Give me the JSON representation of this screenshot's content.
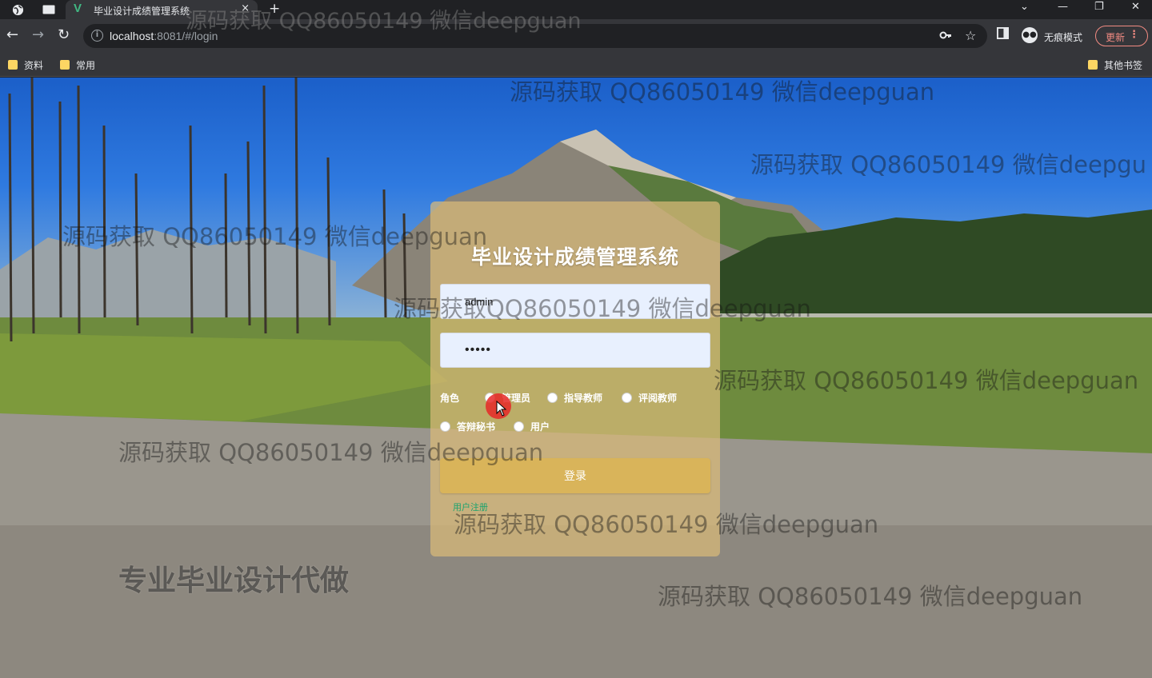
{
  "browser": {
    "tab_title": "毕业设计成绩管理系统",
    "tab_close": "×",
    "new_tab": "+",
    "url_host": "localhost",
    "url_rest": ":8081/#/login",
    "incognito_label": "无痕模式",
    "update_label": "更新",
    "bookmarks": [
      "资料",
      "常用"
    ],
    "other_bookmarks": "其他书签"
  },
  "login": {
    "title": "毕业设计成绩管理系统",
    "username_value": "admin",
    "password_value": "•••••",
    "role_label": "角色",
    "roles": [
      "管理员",
      "指导教师",
      "评阅教师",
      "答辩秘书",
      "用户"
    ],
    "login_button": "登录",
    "register_link": "用户注册"
  },
  "watermarks": {
    "tag": "源码获取 QQ86050149 微信deepguan",
    "tag_short": "源码获取 QQ86050149 微信deepgu",
    "tag_nospace": "源码获取QQ86050149 微信deepguan",
    "slogan": "专业毕业设计代做"
  }
}
